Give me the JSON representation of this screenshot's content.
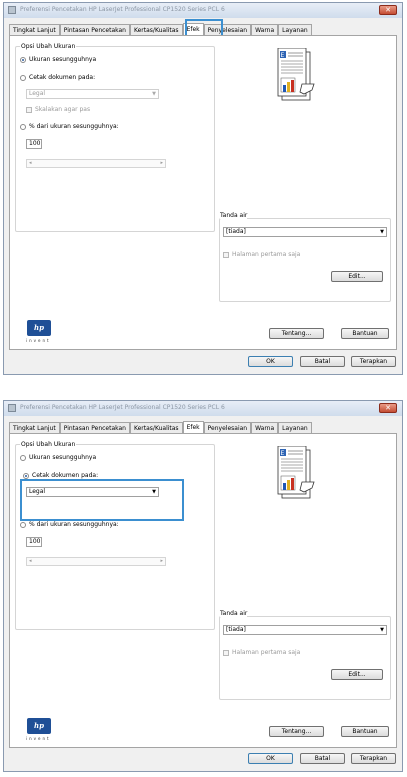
{
  "window": {
    "title": "Preferensi Pencetakan HP LaserJet Professional CP1520 Series PCL 6",
    "close_symbol": "✕"
  },
  "tabs": [
    "Tingkat Lanjut",
    "Pintasan Pencetakan",
    "Kertas/Kualitas",
    "Efek",
    "Penyelesaian",
    "Warna",
    "Layanan"
  ],
  "group_resize": {
    "title": "Opsi Ubah Ukuran",
    "actual_size": "Ukuran sesungguhnya",
    "print_on": "Cetak dokumen pada:",
    "paper_value": "Legal",
    "scale_to_fit": "Skalakan agar pas",
    "percent_label": "% dari ukuran sesungguhnya:",
    "percent_value": "100"
  },
  "watermark": {
    "label": "Tanda air",
    "value": "[tiada]",
    "first_page_only": "Halaman pertama saja",
    "edit_button": "Edit..."
  },
  "footer": {
    "logo_text": "hp",
    "logo_sub": "invent",
    "about_button": "Tentang...",
    "help_button": "Bantuan",
    "ok_button": "OK",
    "cancel_button": "Batal",
    "apply_button": "Terapkan"
  },
  "states": [
    {
      "selected_option": "Ukuran sesungguhnya",
      "paper_enabled": false,
      "highlight": "tab-efek"
    },
    {
      "selected_option": "Cetak dokumen pada:",
      "paper_enabled": true,
      "highlight": "print-on-group"
    }
  ],
  "colors": {
    "highlight": "#3b8fd0",
    "hp_blue": "#1f4f96"
  }
}
